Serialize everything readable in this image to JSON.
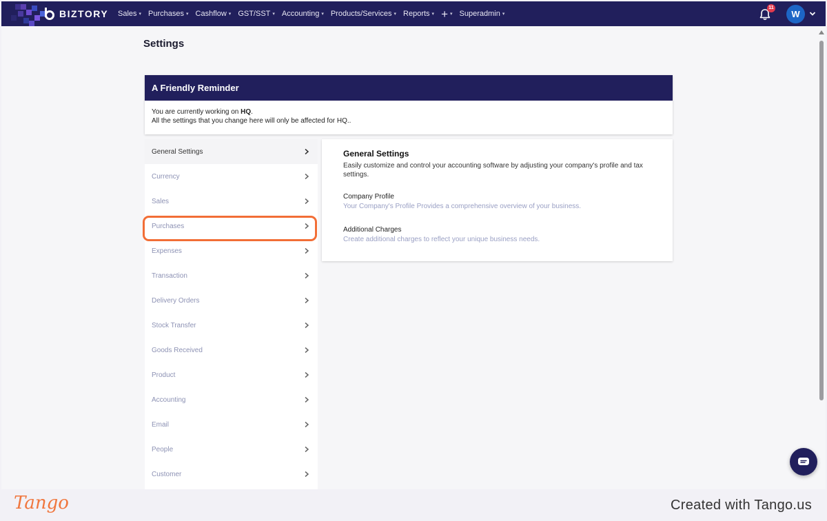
{
  "app": {
    "logo_text": "BIZTORY",
    "colors": {
      "nav_bg": "#211f5c",
      "highlight": "#f26e36",
      "badge": "#e23a4e",
      "avatar": "#1d66c6"
    }
  },
  "nav": {
    "menu": [
      {
        "label": "Sales",
        "name": "nav-sales"
      },
      {
        "label": "Purchases",
        "name": "nav-purchases"
      },
      {
        "label": "Cashflow",
        "name": "nav-cashflow"
      },
      {
        "label": "GST/SST",
        "name": "nav-gst-sst"
      },
      {
        "label": "Accounting",
        "name": "nav-accounting"
      },
      {
        "label": "Products/Services",
        "name": "nav-products-services"
      },
      {
        "label": "Reports",
        "name": "nav-reports"
      },
      {
        "label": "+",
        "name": "nav-add"
      },
      {
        "label": "Superadmin",
        "name": "nav-superadmin"
      }
    ],
    "notification_count": "11",
    "avatar_initial": "W"
  },
  "page": {
    "title": "Settings"
  },
  "reminder": {
    "title": "A Friendly Reminder",
    "line1_prefix": "You are currently working on ",
    "line1_branch": "HQ",
    "line1_suffix": ".",
    "line2": "All the settings that you change here will only be affected for HQ.."
  },
  "sidebar": {
    "items": [
      {
        "label": "General Settings",
        "name": "sidebar-item-general-settings",
        "active": true
      },
      {
        "label": "Currency",
        "name": "sidebar-item-currency"
      },
      {
        "label": "Sales",
        "name": "sidebar-item-sales"
      },
      {
        "label": "Purchases",
        "name": "sidebar-item-purchases"
      },
      {
        "label": "Expenses",
        "name": "sidebar-item-expenses"
      },
      {
        "label": "Transaction",
        "name": "sidebar-item-transaction"
      },
      {
        "label": "Delivery Orders",
        "name": "sidebar-item-delivery-orders"
      },
      {
        "label": "Stock Transfer",
        "name": "sidebar-item-stock-transfer"
      },
      {
        "label": "Goods Received",
        "name": "sidebar-item-goods-received"
      },
      {
        "label": "Product",
        "name": "sidebar-item-product"
      },
      {
        "label": "Accounting",
        "name": "sidebar-item-accounting"
      },
      {
        "label": "Email",
        "name": "sidebar-item-email"
      },
      {
        "label": "People",
        "name": "sidebar-item-people"
      },
      {
        "label": "Customer",
        "name": "sidebar-item-customer"
      }
    ]
  },
  "content": {
    "title": "General Settings",
    "description": "Easily customize and control your accounting software by adjusting your company's profile and tax settings.",
    "links": [
      {
        "title": "Company Profile",
        "description": "Your Company's Profile Provides a comprehensive overview of your business."
      },
      {
        "title": "Additional Charges",
        "description": "Create additional charges to reflect your unique business needs."
      }
    ]
  },
  "footer": {
    "tango_logo": "Tango",
    "created_with": "Created with Tango.us"
  }
}
